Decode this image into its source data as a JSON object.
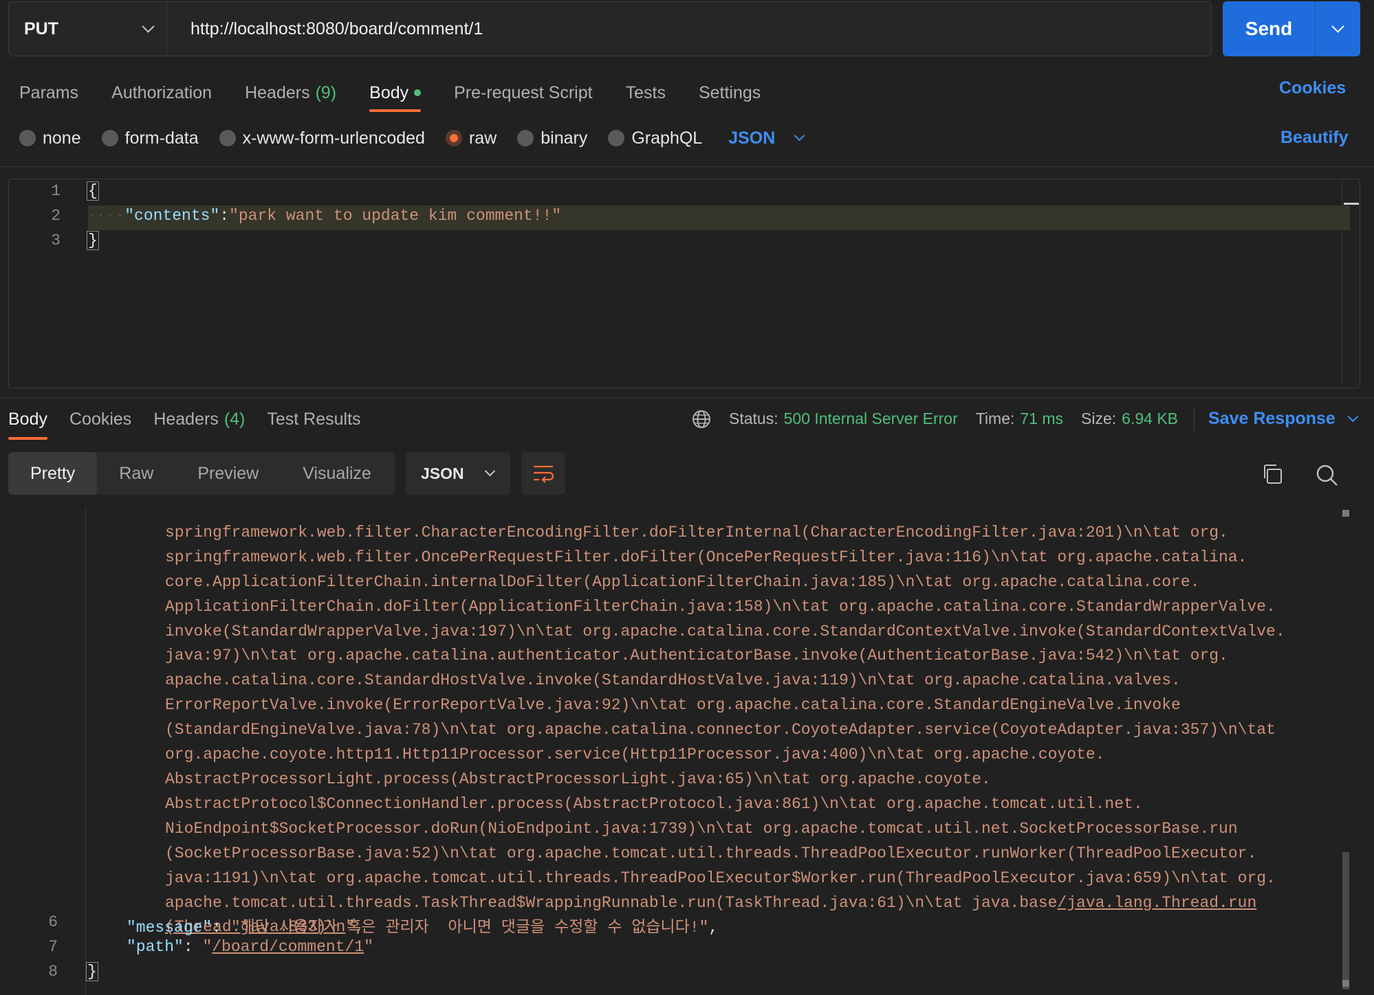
{
  "request": {
    "method": "PUT",
    "url": "http://localhost:8080/board/comment/1",
    "send_label": "Send"
  },
  "request_tabs": {
    "params": "Params",
    "authorization": "Authorization",
    "headers": "Headers",
    "headers_count": "(9)",
    "body": "Body",
    "pre_request": "Pre-request Script",
    "tests": "Tests",
    "settings": "Settings",
    "cookies": "Cookies"
  },
  "body_types": {
    "none": "none",
    "form_data": "form-data",
    "urlencoded": "x-www-form-urlencoded",
    "raw": "raw",
    "binary": "binary",
    "graphql": "GraphQL",
    "language": "JSON",
    "beautify": "Beautify",
    "selected": "raw"
  },
  "request_body": {
    "line_numbers": [
      "1",
      "2",
      "3"
    ],
    "open_brace": "{",
    "indent": "····",
    "key": "\"contents\"",
    "colon": ":",
    "value": "\"park want to update kim comment!!\"",
    "close_brace": "}"
  },
  "response": {
    "tabs": {
      "body": "Body",
      "cookies": "Cookies",
      "headers": "Headers",
      "headers_count": "(4)",
      "test_results": "Test Results"
    },
    "status_label": "Status:",
    "status_value": "500 Internal Server Error",
    "time_label": "Time:",
    "time_value": "71 ms",
    "size_label": "Size:",
    "size_value": "6.94 KB",
    "save_response": "Save Response",
    "views": {
      "pretty": "Pretty",
      "raw": "Raw",
      "preview": "Preview",
      "visualize": "Visualize"
    },
    "format": "JSON",
    "trace_lines": [
      "springframework.web.filter.CharacterEncodingFilter.doFilterInternal(CharacterEncodingFilter.java:201)\\n\\tat org.",
      "springframework.web.filter.OncePerRequestFilter.doFilter(OncePerRequestFilter.java:116)\\n\\tat org.apache.catalina.",
      "core.ApplicationFilterChain.internalDoFilter(ApplicationFilterChain.java:185)\\n\\tat org.apache.catalina.core.",
      "ApplicationFilterChain.doFilter(ApplicationFilterChain.java:158)\\n\\tat org.apache.catalina.core.StandardWrapperValve.",
      "invoke(StandardWrapperValve.java:197)\\n\\tat org.apache.catalina.core.StandardContextValve.invoke(StandardContextValve.",
      "java:97)\\n\\tat org.apache.catalina.authenticator.AuthenticatorBase.invoke(AuthenticatorBase.java:542)\\n\\tat org.",
      "apache.catalina.core.StandardHostValve.invoke(StandardHostValve.java:119)\\n\\tat org.apache.catalina.valves.",
      "ErrorReportValve.invoke(ErrorReportValve.java:92)\\n\\tat org.apache.catalina.core.StandardEngineValve.invoke",
      "(StandardEngineValve.java:78)\\n\\tat org.apache.catalina.connector.CoyoteAdapter.service(CoyoteAdapter.java:357)\\n\\tat",
      "org.apache.coyote.http11.Http11Processor.service(Http11Processor.java:400)\\n\\tat org.apache.coyote.",
      "AbstractProcessorLight.process(AbstractProcessorLight.java:65)\\n\\tat org.apache.coyote.",
      "AbstractProtocol$ConnectionHandler.process(AbstractProtocol.java:861)\\n\\tat org.apache.tomcat.util.net.",
      "NioEndpoint$SocketProcessor.doRun(NioEndpoint.java:1739)\\n\\tat org.apache.tomcat.util.net.SocketProcessorBase.run",
      "(SocketProcessorBase.java:52)\\n\\tat org.apache.tomcat.util.threads.ThreadPoolExecutor.runWorker(ThreadPoolExecutor.",
      "java:1191)\\n\\tat org.apache.tomcat.util.threads.ThreadPoolExecutor$Worker.run(ThreadPoolExecutor.java:659)\\n\\tat org.",
      "apache.tomcat.util.threads.TaskThread$WrappingRunnable.run(TaskThread.java:61)\\n\\tat java.base"
    ],
    "trace_link_1": "/java.lang.Thread.run",
    "trace_link_2": "(Thread.java:833)\\n",
    "trace_end": "\",",
    "message_line_number": "6",
    "message_key": "\"message\"",
    "message_value": "\"해당 사용자가 혹은 관리자  아니면 댓글을 수정할 수 없습니다!\"",
    "path_line_number": "7",
    "path_key": "\"path\"",
    "path_value": "/board/comment/1",
    "close_line_number": "8",
    "close_brace": "}"
  },
  "colors": {
    "accent": "#ff6c37",
    "link": "#3e8ef7",
    "success_text": "#4fbf7a",
    "string": "#ce9178",
    "key": "#9cdcfe"
  }
}
